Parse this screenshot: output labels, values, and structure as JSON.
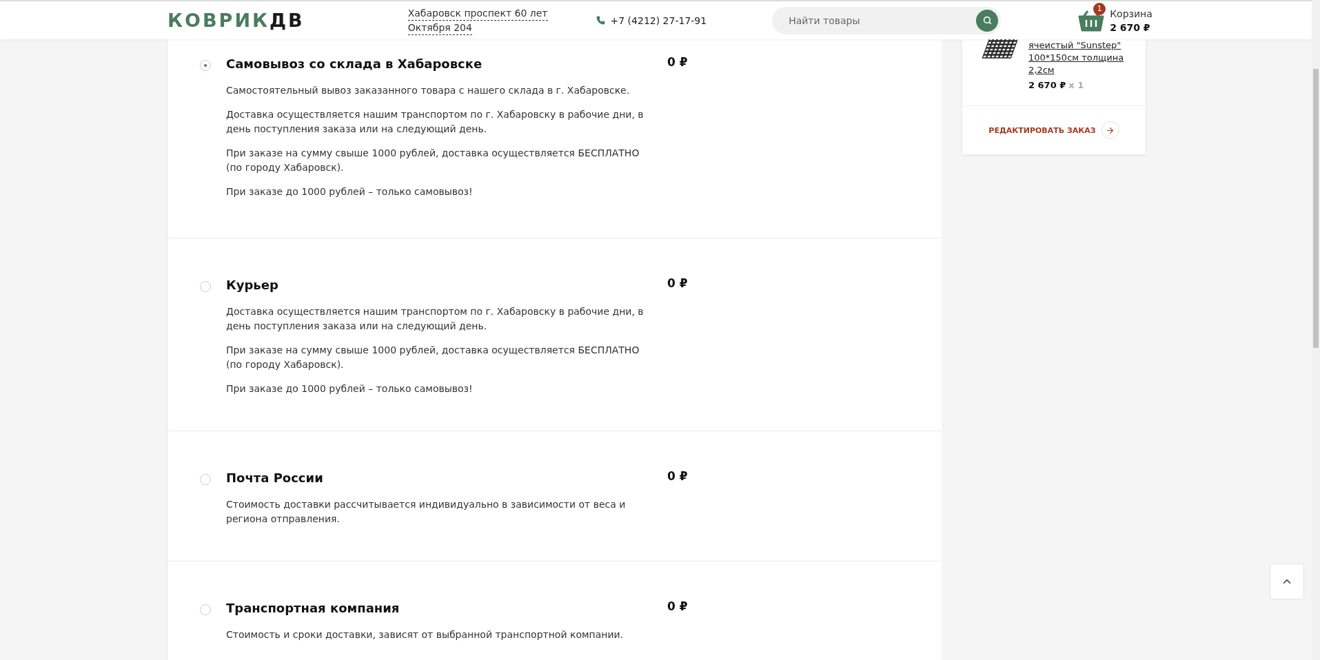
{
  "header": {
    "logo": {
      "main": "КОВРИК",
      "accent": "ДВ"
    },
    "address": [
      "Хабаровск проспект 60 лет",
      "Октября 204"
    ],
    "phone": "+7 (4212) 27-17-91",
    "search": {
      "placeholder": "Найти товары"
    },
    "cart": {
      "count": "1",
      "label": "Корзина",
      "total": "2 670 ₽"
    }
  },
  "delivery_options": [
    {
      "title": "Самовывоз со склада в Хабаровске",
      "price": "0 ₽",
      "selected": true,
      "paragraphs": [
        "Самостоятельный вывоз заказанного товара с нашего склада в г. Хабаровске.",
        "Доставка осуществляется нашим транспортом по г. Хабаровску в рабочие дни, в день поступления заказа или на следующий день.",
        "При заказе на сумму свыше 1000 рублей, доставка осуществляется БЕСПЛАТНО (по городу Хабаровск).",
        "При заказе до 1000 рублей – только самовывоз!"
      ]
    },
    {
      "title": "Курьер",
      "price": "0 ₽",
      "selected": false,
      "paragraphs": [
        "Доставка осуществляется нашим транспортом по г. Хабаровску в рабочие дни, в день поступления заказа или на следующий день.",
        "При заказе на сумму свыше 1000 рублей, доставка осуществляется БЕСПЛАТНО (по городу Хабаровск).",
        "При заказе до 1000 рублей – только самовывоз!"
      ]
    },
    {
      "title": "Почта России",
      "price": "0 ₽",
      "selected": false,
      "paragraphs": [
        "Стоимость доставки рассчитывается индивидуально в зависимости от веса и региона отправления."
      ]
    },
    {
      "title": "Транспортная компания",
      "price": "0 ₽",
      "selected": false,
      "paragraphs": [
        "Стоимость и сроки доставки, зависят от выбранной транспортной компании."
      ]
    }
  ],
  "order_summary": {
    "item": {
      "name_lines": [
        "ячеистый \"Sunstep\"",
        "100*150см толщина",
        "2,2см"
      ],
      "price": "2 670 ₽",
      "quantity": "x 1"
    },
    "edit_link": "РЕДАКТИРОВАТЬ ЗАКАЗ"
  }
}
